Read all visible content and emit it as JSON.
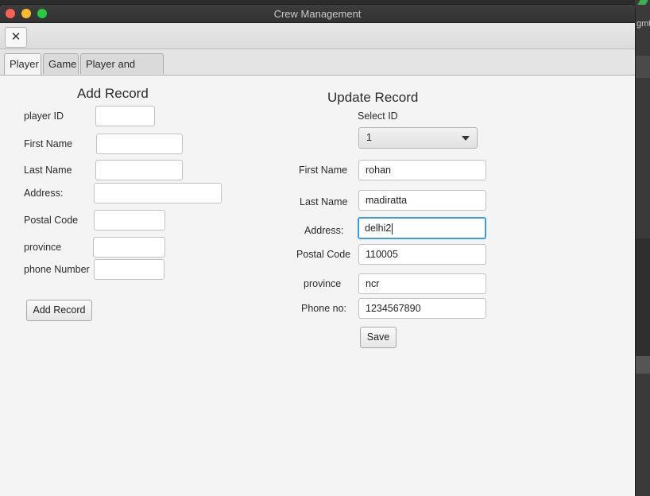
{
  "window": {
    "title": "Crew Management"
  },
  "background": {
    "text": "gmt"
  },
  "toolbar": {
    "close_glyph": "✕"
  },
  "tabs": [
    {
      "label": "Player",
      "active": true
    },
    {
      "label": "Game",
      "active": false
    },
    {
      "label": "Player and Game",
      "active": false
    }
  ],
  "add_record": {
    "heading": "Add Record",
    "fields": [
      {
        "label": "player ID",
        "value": ""
      },
      {
        "label": "First Name",
        "value": ""
      },
      {
        "label": "Last Name",
        "value": ""
      },
      {
        "label": "Address:",
        "value": ""
      },
      {
        "label": "Postal Code",
        "value": ""
      },
      {
        "label": "province",
        "value": ""
      },
      {
        "label": "phone Number",
        "value": ""
      }
    ],
    "button": "Add Record"
  },
  "update_record": {
    "heading": "Update Record",
    "select_label": "Select ID",
    "select_value": "1",
    "fields": [
      {
        "label": "First Name",
        "value": "rohan"
      },
      {
        "label": "Last Name",
        "value": "madiratta"
      },
      {
        "label": "Address:",
        "value": "delhi2"
      },
      {
        "label": "Postal Code",
        "value": "110005"
      },
      {
        "label": "province",
        "value": "ncr"
      },
      {
        "label": "Phone no:",
        "value": "1234567890"
      }
    ],
    "button": "Save"
  },
  "colors": {
    "focus": "#3d9be9",
    "titlebar": "#353535",
    "panel": "#f4f4f4"
  }
}
